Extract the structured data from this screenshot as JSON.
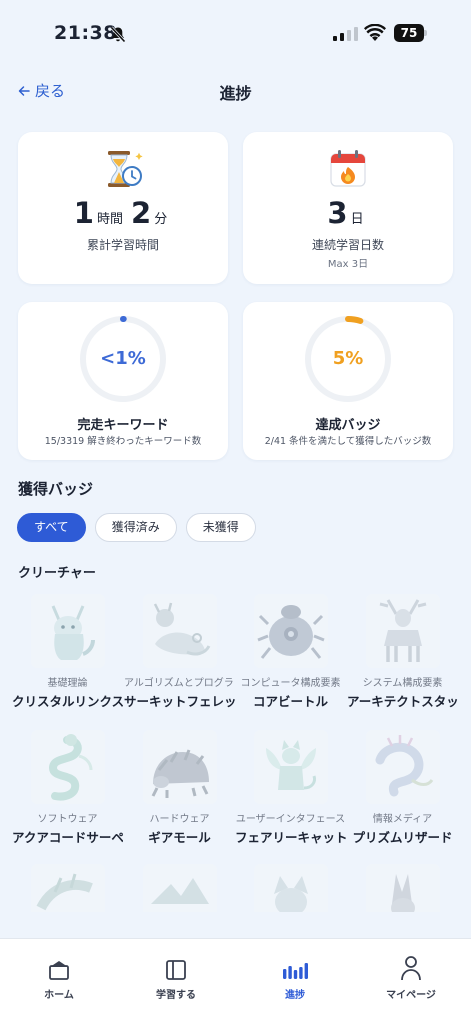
{
  "status_bar": {
    "time": "21:38",
    "battery": "75"
  },
  "header": {
    "back_label": "戻る",
    "title": "進捗"
  },
  "stats": {
    "study_time": {
      "hours": "1",
      "hours_unit": "時間",
      "minutes": "2",
      "minutes_unit": "分",
      "label": "累計学習時間",
      "icon": "hourglass-icon"
    },
    "streak": {
      "days": "3",
      "days_unit": "日",
      "label": "連続学習日数",
      "sub": "Max 3日",
      "icon": "calendar-fire-icon"
    },
    "keywords": {
      "percent_text": "<1%",
      "fraction": 0.003,
      "label": "完走キーワード",
      "sub": "15/3319 解き終わったキーワード数"
    },
    "badges": {
      "percent_text": "5%",
      "fraction": 0.05,
      "label": "達成バッジ",
      "sub": "2/41 条件を満たして獲得したバッジ数"
    }
  },
  "badges_section": {
    "title": "獲得バッジ",
    "filters": [
      {
        "label": "すべて",
        "active": true
      },
      {
        "label": "獲得済み",
        "active": false
      },
      {
        "label": "未獲得",
        "active": false
      }
    ],
    "category_title": "クリーチャー",
    "items": [
      {
        "category": "基礎理論",
        "name": "クリスタルリンクス",
        "icon": "lynx-creature-icon"
      },
      {
        "category": "アルゴリズムとプログラミング",
        "name": "サーキットフェレット",
        "icon": "ferret-creature-icon"
      },
      {
        "category": "コンピュータ構成要素",
        "name": "コアビートル",
        "icon": "beetle-creature-icon"
      },
      {
        "category": "システム構成要素",
        "name": "アーキテクトスタッグ",
        "icon": "stag-creature-icon"
      },
      {
        "category": "ソフトウェア",
        "name": "アクアコードサーペント",
        "icon": "serpent-creature-icon"
      },
      {
        "category": "ハードウェア",
        "name": "ギアモール",
        "icon": "mole-creature-icon"
      },
      {
        "category": "ユーザーインタフェース",
        "name": "フェアリーキャット",
        "icon": "fairy-cat-creature-icon"
      },
      {
        "category": "情報メディア",
        "name": "プリズムリザード",
        "icon": "lizard-creature-icon"
      },
      {
        "category": "",
        "name": "",
        "icon": "dragon-creature-icon"
      },
      {
        "category": "",
        "name": "",
        "icon": "wyvern-creature-icon"
      },
      {
        "category": "",
        "name": "",
        "icon": "cat-creature-icon"
      },
      {
        "category": "",
        "name": "",
        "icon": "jackal-creature-icon"
      }
    ]
  },
  "tabbar": {
    "items": [
      {
        "label": "ホーム",
        "icon": "home-icon",
        "active": false
      },
      {
        "label": "学習する",
        "icon": "book-icon",
        "active": false
      },
      {
        "label": "進捗",
        "icon": "progress-bars-icon",
        "active": true
      },
      {
        "label": "マイページ",
        "icon": "person-icon",
        "active": false
      }
    ]
  },
  "colors": {
    "accent": "#2e5bd6",
    "keyword_ring": "#3d6ad6",
    "badge_ring": "#f0a020",
    "background": "#eef4fc"
  }
}
